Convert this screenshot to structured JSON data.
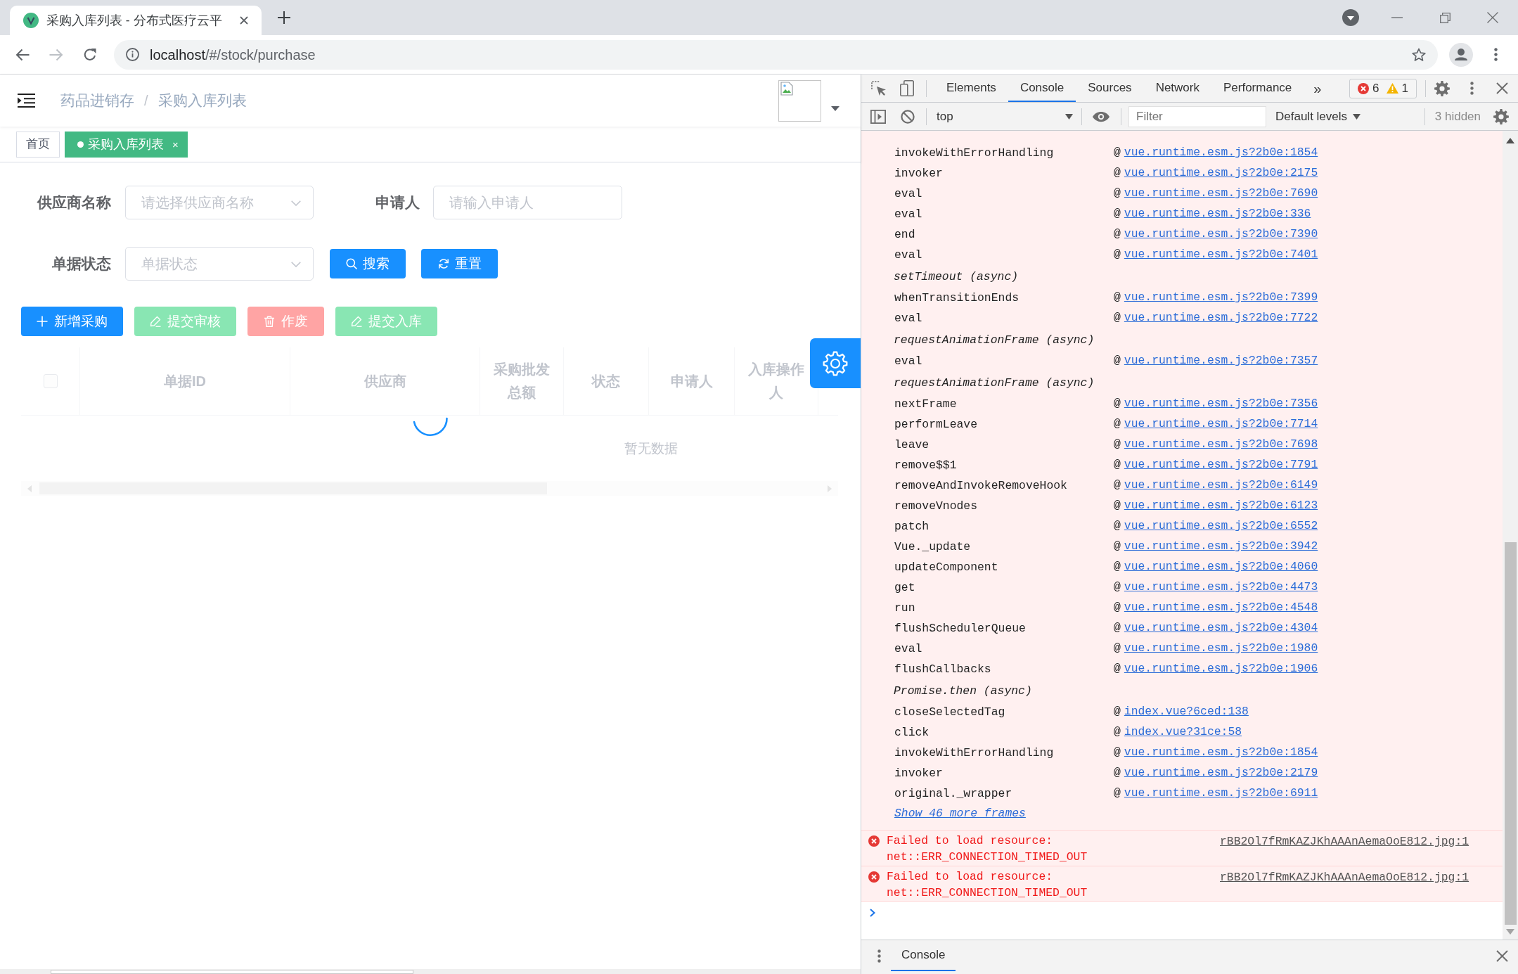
{
  "browser": {
    "tab": {
      "title": "采购入库列表 - 分布式医疗云平"
    },
    "url_host": "localhost",
    "url_path": "/#/stock/purchase"
  },
  "app": {
    "breadcrumb": [
      {
        "label": "药品进销存"
      },
      {
        "label": "采购入库列表"
      }
    ],
    "breadcrumb_separator": "/",
    "tags": [
      {
        "label": "首页",
        "selected": false
      },
      {
        "label": "采购入库列表",
        "selected": true,
        "close": "×"
      }
    ],
    "filters": [
      {
        "label": "供应商名称",
        "kind": "select",
        "placeholder": "请选择供应商名称"
      },
      {
        "label": "申请人",
        "kind": "input",
        "placeholder": "请输入申请人"
      },
      {
        "label": "单据状态",
        "kind": "select",
        "placeholder": "单据状态"
      }
    ],
    "search_buttons": [
      {
        "label": "搜索",
        "kind": "search"
      },
      {
        "label": "重置",
        "kind": "reset"
      }
    ],
    "actions": [
      {
        "label": "新增采购",
        "kind": "create",
        "disabled": false
      },
      {
        "label": "提交审核",
        "kind": "submit",
        "disabled": true
      },
      {
        "label": "作废",
        "kind": "void",
        "disabled": true
      },
      {
        "label": "提交入库",
        "kind": "submit",
        "disabled": true
      }
    ],
    "table": {
      "loading": true,
      "select_all_checked": false,
      "columns": [
        "单据ID",
        "供应商",
        "采购批发总额",
        "状态",
        "申请人",
        "入库操作人"
      ],
      "empty_text": "暂无数据"
    }
  },
  "devtools": {
    "tabs": [
      {
        "label": "Elements",
        "selected": false
      },
      {
        "label": "Console",
        "selected": true
      },
      {
        "label": "Sources",
        "selected": false
      },
      {
        "label": "Network",
        "selected": false
      },
      {
        "label": "Performance",
        "selected": false
      }
    ],
    "more_tabs": "»",
    "error_count": "6",
    "warning_count": "1",
    "context": "top",
    "filter_placeholder": "Filter",
    "levels": "Default levels",
    "hidden": "3 hidden",
    "stack": [
      {
        "kind": "frame",
        "function": "invokeWithErrorHandling",
        "at": "@",
        "source": "vue.runtime.esm.js?2b0e:1854"
      },
      {
        "kind": "frame",
        "function": "invoker",
        "at": "@",
        "source": "vue.runtime.esm.js?2b0e:2175"
      },
      {
        "kind": "frame",
        "function": "eval",
        "at": "@",
        "source": "vue.runtime.esm.js?2b0e:7690"
      },
      {
        "kind": "frame",
        "function": "eval",
        "at": "@",
        "source": "vue.runtime.esm.js?2b0e:336"
      },
      {
        "kind": "frame",
        "function": "end",
        "at": "@",
        "source": "vue.runtime.esm.js?2b0e:7390"
      },
      {
        "kind": "frame",
        "function": "eval",
        "at": "@",
        "source": "vue.runtime.esm.js?2b0e:7401"
      },
      {
        "kind": "async",
        "label": "setTimeout (async)"
      },
      {
        "kind": "frame",
        "function": "whenTransitionEnds",
        "at": "@",
        "source": "vue.runtime.esm.js?2b0e:7399"
      },
      {
        "kind": "frame",
        "function": "eval",
        "at": "@",
        "source": "vue.runtime.esm.js?2b0e:7722"
      },
      {
        "kind": "async",
        "label": "requestAnimationFrame (async)"
      },
      {
        "kind": "frame",
        "function": "eval",
        "at": "@",
        "source": "vue.runtime.esm.js?2b0e:7357"
      },
      {
        "kind": "async",
        "label": "requestAnimationFrame (async)"
      },
      {
        "kind": "frame",
        "function": "nextFrame",
        "at": "@",
        "source": "vue.runtime.esm.js?2b0e:7356"
      },
      {
        "kind": "frame",
        "function": "performLeave",
        "at": "@",
        "source": "vue.runtime.esm.js?2b0e:7714"
      },
      {
        "kind": "frame",
        "function": "leave",
        "at": "@",
        "source": "vue.runtime.esm.js?2b0e:7698"
      },
      {
        "kind": "frame",
        "function": "remove$$1",
        "at": "@",
        "source": "vue.runtime.esm.js?2b0e:7791"
      },
      {
        "kind": "frame",
        "function": "removeAndInvokeRemoveHook",
        "at": "@",
        "source": "vue.runtime.esm.js?2b0e:6149"
      },
      {
        "kind": "frame",
        "function": "removeVnodes",
        "at": "@",
        "source": "vue.runtime.esm.js?2b0e:6123"
      },
      {
        "kind": "frame",
        "function": "patch",
        "at": "@",
        "source": "vue.runtime.esm.js?2b0e:6552"
      },
      {
        "kind": "frame",
        "function": "Vue._update",
        "at": "@",
        "source": "vue.runtime.esm.js?2b0e:3942"
      },
      {
        "kind": "frame",
        "function": "updateComponent",
        "at": "@",
        "source": "vue.runtime.esm.js?2b0e:4060"
      },
      {
        "kind": "frame",
        "function": "get",
        "at": "@",
        "source": "vue.runtime.esm.js?2b0e:4473"
      },
      {
        "kind": "frame",
        "function": "run",
        "at": "@",
        "source": "vue.runtime.esm.js?2b0e:4548"
      },
      {
        "kind": "frame",
        "function": "flushSchedulerQueue",
        "at": "@",
        "source": "vue.runtime.esm.js?2b0e:4304"
      },
      {
        "kind": "frame",
        "function": "eval",
        "at": "@",
        "source": "vue.runtime.esm.js?2b0e:1980"
      },
      {
        "kind": "frame",
        "function": "flushCallbacks",
        "at": "@",
        "source": "vue.runtime.esm.js?2b0e:1906"
      },
      {
        "kind": "async",
        "label": "Promise.then (async)"
      },
      {
        "kind": "frame",
        "function": "closeSelectedTag",
        "at": "@",
        "source": "index.vue?6ced:138"
      },
      {
        "kind": "frame",
        "function": "click",
        "at": "@",
        "source": "index.vue?31ce:58"
      },
      {
        "kind": "frame",
        "function": "invokeWithErrorHandling",
        "at": "@",
        "source": "vue.runtime.esm.js?2b0e:1854"
      },
      {
        "kind": "frame",
        "function": "invoker",
        "at": "@",
        "source": "vue.runtime.esm.js?2b0e:2179"
      },
      {
        "kind": "frame",
        "function": "original._wrapper",
        "at": "@",
        "source": "vue.runtime.esm.js?2b0e:6911"
      }
    ],
    "show_more": "Show 46 more frames",
    "messages": [
      {
        "kind": "error",
        "text": "Failed to load resource: net::ERR_CONNECTION_TIMED_OUT",
        "source": "rBB2Ol7fRmKAZJKhAAAnAemaOoE812.jpg:1"
      },
      {
        "kind": "error",
        "text": "Failed to load resource: net::ERR_CONNECTION_TIMED_OUT",
        "source": "rBB2Ol7fRmKAZJKhAAAnAemaOoE812.jpg:1"
      }
    ],
    "drawer_tabs": [
      {
        "label": "Console",
        "selected": true
      }
    ]
  }
}
